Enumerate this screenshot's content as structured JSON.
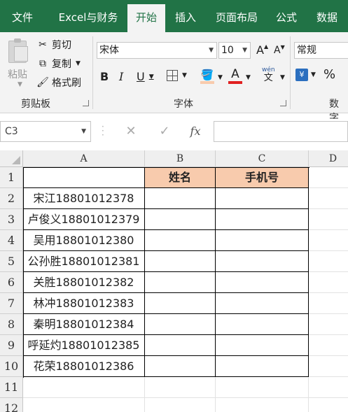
{
  "ribbon_tabs": [
    "文件",
    "Excel与财务",
    "开始",
    "插入",
    "页面布局",
    "公式",
    "数据"
  ],
  "active_tab": "开始",
  "clipboard": {
    "paste_label": "粘贴",
    "cut_label": "剪切",
    "copy_label": "复制",
    "format_painter_label": "格式刷",
    "group_label": "剪贴板"
  },
  "font": {
    "family": "宋体",
    "size": "10",
    "grow_label": "A",
    "shrink_label": "A",
    "bold": "B",
    "italic": "I",
    "underline": "U",
    "font_color_label": "A",
    "pinyin_top": "wén",
    "pinyin_bottom": "文",
    "group_label": "字体",
    "font_color_hex": "#e02020",
    "fill_color_hex": "#f8cbad"
  },
  "number": {
    "format": "常规",
    "percent": "%",
    "group_label": "数字"
  },
  "formula_bar": {
    "name_box": "C3",
    "cancel_icon": "✕",
    "enter_icon": "✓",
    "fx_label": "fx",
    "formula": ""
  },
  "columns": [
    "A",
    "B",
    "C",
    "D"
  ],
  "rows": [
    "1",
    "2",
    "3",
    "4",
    "5",
    "6",
    "7",
    "8",
    "9",
    "10",
    "11",
    "12"
  ],
  "header_row": {
    "b": "姓名",
    "c": "手机号"
  },
  "data_a": [
    "宋江18801012378",
    "卢俊义18801012379",
    "吴用18801012380",
    "公孙胜18801012381",
    "关胜18801012382",
    "林冲18801012383",
    "秦明18801012384",
    "呼延灼18801012385",
    "花荣18801012386"
  ],
  "colors": {
    "ribbon_green": "#217346",
    "header_fill": "#f8cbad"
  }
}
